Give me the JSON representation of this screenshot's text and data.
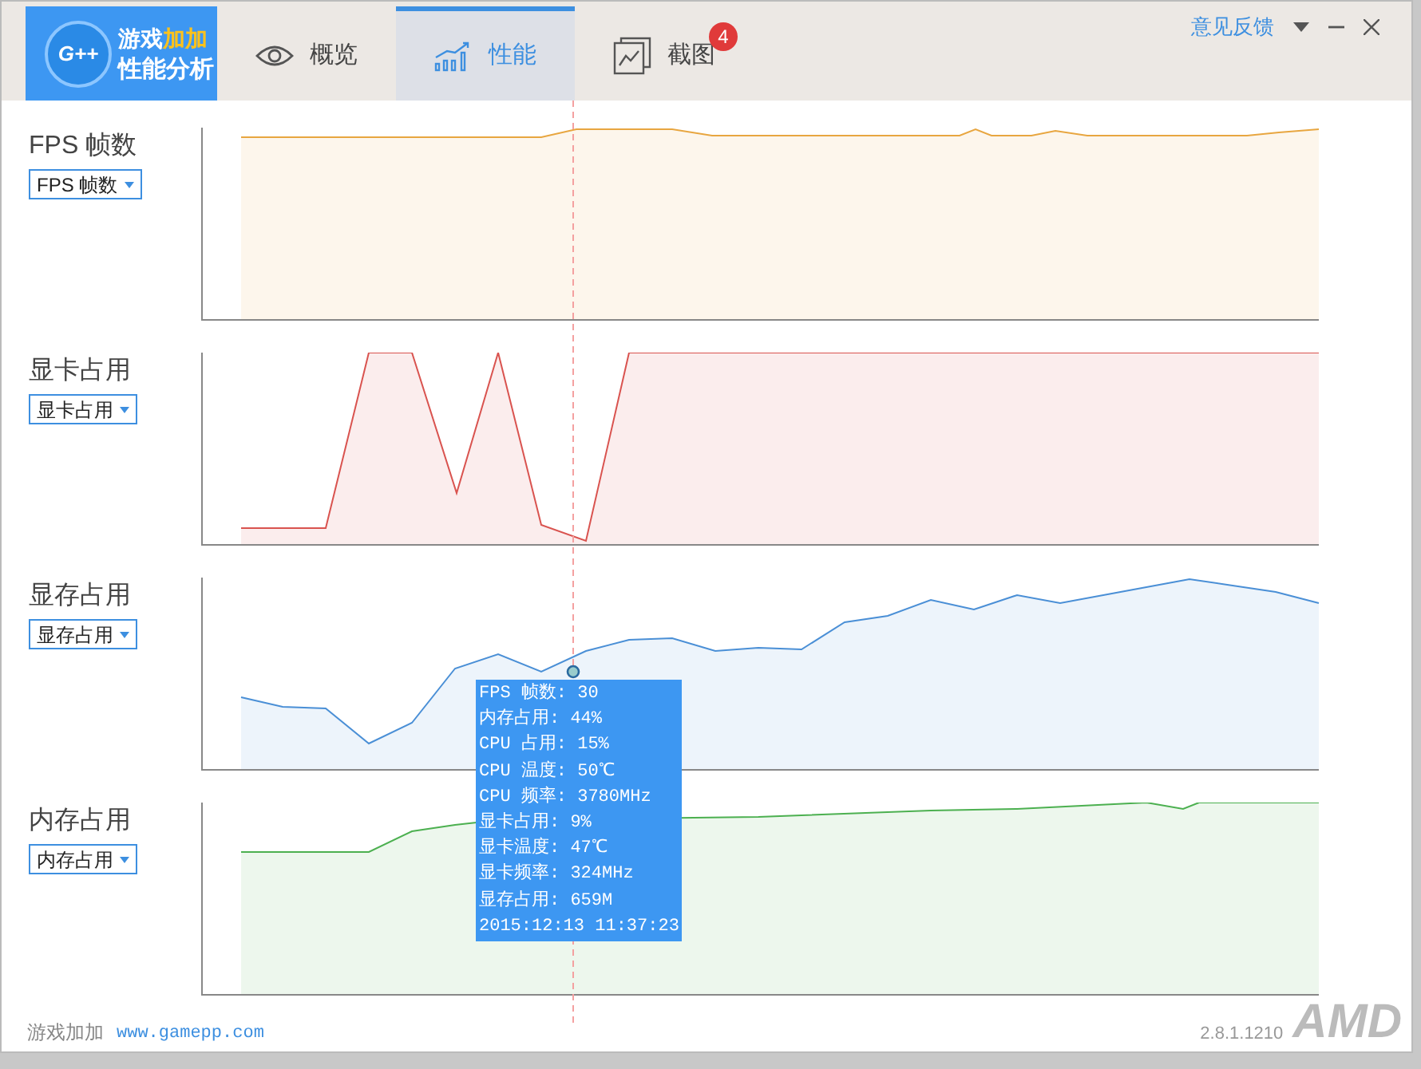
{
  "logo": {
    "title_part1": "游戏",
    "title_part2": "加加",
    "subtitle": "性能分析",
    "badge_text": "G++"
  },
  "tabs": [
    {
      "label": "概览",
      "selected": false
    },
    {
      "label": "性能",
      "selected": true
    },
    {
      "label": "截图",
      "selected": false,
      "badge": "4"
    }
  ],
  "feedback_link": "意见反馈",
  "charts": [
    {
      "title": "FPS 帧数",
      "dropdown": "FPS 帧数",
      "color": "#e8a640"
    },
    {
      "title": "显卡占用",
      "dropdown": "显卡占用",
      "color": "#d9534f"
    },
    {
      "title": "显存占用",
      "dropdown": "显存占用",
      "color": "#4a8fd6"
    },
    {
      "title": "内存占用",
      "dropdown": "内存占用",
      "color": "#4cb050"
    }
  ],
  "tooltip": [
    "FPS 帧数: 30",
    "内存占用: 44%",
    "CPU 占用: 15%",
    "CPU 温度: 50℃",
    "CPU 频率: 3780MHz",
    "显卡占用: 9%",
    "显卡温度: 47℃",
    "显卡频率: 324MHz",
    "显存占用: 659M",
    "2015:12:13 11:37:23"
  ],
  "footer": {
    "brand": "游戏加加",
    "url": "www.gamepp.com",
    "version": "2.8.1.1210",
    "amd_logo": "AMD"
  }
}
